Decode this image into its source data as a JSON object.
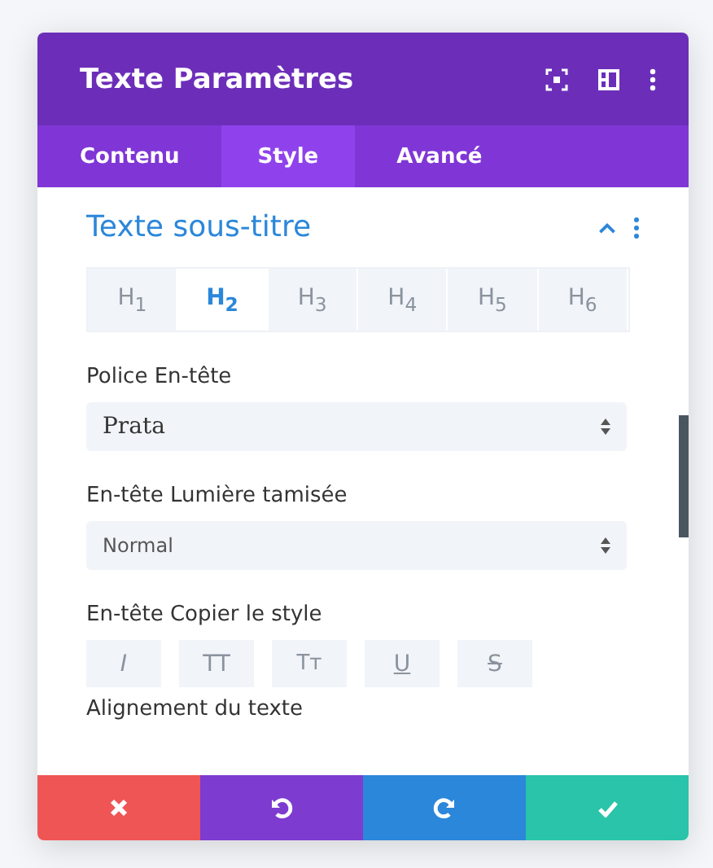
{
  "window": {
    "title": "Texte Paramètres"
  },
  "tabs": [
    {
      "label": "Contenu",
      "selected": false
    },
    {
      "label": "Style",
      "selected": true
    },
    {
      "label": "Avancé",
      "selected": false
    }
  ],
  "section": {
    "title": "Texte sous-titre",
    "expanded": true
  },
  "heading_levels": [
    {
      "label": "H$_{1}$",
      "selected": false
    },
    {
      "label": "H$_{2}$",
      "selected": true
    },
    {
      "label": "H$_{3}$",
      "selected": false
    },
    {
      "label": "H$_{4}$",
      "selected": false
    },
    {
      "label": "H$_{5}$",
      "selected": false
    },
    {
      "label": "H$_{6}$",
      "selected": false
    }
  ],
  "fields": [
    {
      "label": "Police En-tête",
      "value": "Prata",
      "kind": "serif"
    },
    {
      "label": "En-tête Lumière tamisée",
      "value": "Normal",
      "kind": "sans"
    }
  ],
  "text_style": {
    "label": "En-tête Copier le style",
    "buttons": [
      {
        "label": "I",
        "kind": "italic",
        "selected": false
      },
      {
        "label": "TT",
        "kind": "uppercase",
        "selected": false
      },
      {
        "label": "Tт",
        "kind": "smallcaps",
        "selected": false
      },
      {
        "label": "U",
        "kind": "underline",
        "selected": false
      },
      {
        "label": "S",
        "kind": "strike",
        "selected": false
      }
    ]
  },
  "next_label": "Alignement du texte"
}
